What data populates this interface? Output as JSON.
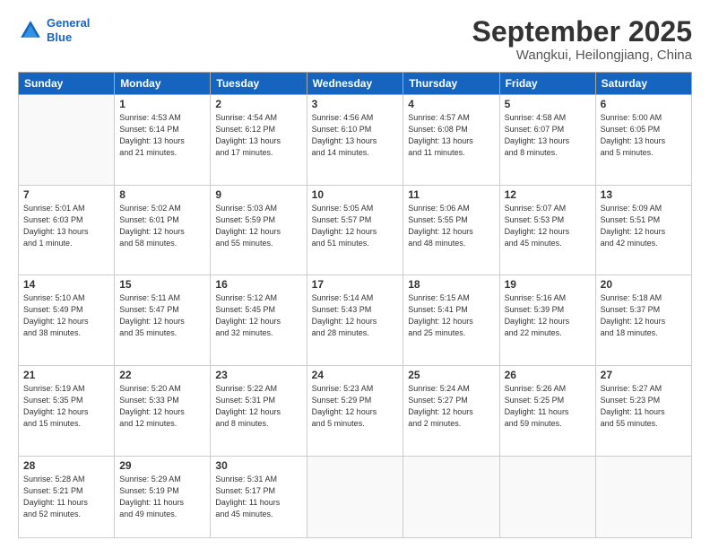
{
  "header": {
    "logo_line1": "General",
    "logo_line2": "Blue",
    "month": "September 2025",
    "location": "Wangkui, Heilongjiang, China"
  },
  "days_of_week": [
    "Sunday",
    "Monday",
    "Tuesday",
    "Wednesday",
    "Thursday",
    "Friday",
    "Saturday"
  ],
  "weeks": [
    [
      {
        "day": "",
        "info": ""
      },
      {
        "day": "1",
        "info": "Sunrise: 4:53 AM\nSunset: 6:14 PM\nDaylight: 13 hours\nand 21 minutes."
      },
      {
        "day": "2",
        "info": "Sunrise: 4:54 AM\nSunset: 6:12 PM\nDaylight: 13 hours\nand 17 minutes."
      },
      {
        "day": "3",
        "info": "Sunrise: 4:56 AM\nSunset: 6:10 PM\nDaylight: 13 hours\nand 14 minutes."
      },
      {
        "day": "4",
        "info": "Sunrise: 4:57 AM\nSunset: 6:08 PM\nDaylight: 13 hours\nand 11 minutes."
      },
      {
        "day": "5",
        "info": "Sunrise: 4:58 AM\nSunset: 6:07 PM\nDaylight: 13 hours\nand 8 minutes."
      },
      {
        "day": "6",
        "info": "Sunrise: 5:00 AM\nSunset: 6:05 PM\nDaylight: 13 hours\nand 5 minutes."
      }
    ],
    [
      {
        "day": "7",
        "info": "Sunrise: 5:01 AM\nSunset: 6:03 PM\nDaylight: 13 hours\nand 1 minute."
      },
      {
        "day": "8",
        "info": "Sunrise: 5:02 AM\nSunset: 6:01 PM\nDaylight: 12 hours\nand 58 minutes."
      },
      {
        "day": "9",
        "info": "Sunrise: 5:03 AM\nSunset: 5:59 PM\nDaylight: 12 hours\nand 55 minutes."
      },
      {
        "day": "10",
        "info": "Sunrise: 5:05 AM\nSunset: 5:57 PM\nDaylight: 12 hours\nand 51 minutes."
      },
      {
        "day": "11",
        "info": "Sunrise: 5:06 AM\nSunset: 5:55 PM\nDaylight: 12 hours\nand 48 minutes."
      },
      {
        "day": "12",
        "info": "Sunrise: 5:07 AM\nSunset: 5:53 PM\nDaylight: 12 hours\nand 45 minutes."
      },
      {
        "day": "13",
        "info": "Sunrise: 5:09 AM\nSunset: 5:51 PM\nDaylight: 12 hours\nand 42 minutes."
      }
    ],
    [
      {
        "day": "14",
        "info": "Sunrise: 5:10 AM\nSunset: 5:49 PM\nDaylight: 12 hours\nand 38 minutes."
      },
      {
        "day": "15",
        "info": "Sunrise: 5:11 AM\nSunset: 5:47 PM\nDaylight: 12 hours\nand 35 minutes."
      },
      {
        "day": "16",
        "info": "Sunrise: 5:12 AM\nSunset: 5:45 PM\nDaylight: 12 hours\nand 32 minutes."
      },
      {
        "day": "17",
        "info": "Sunrise: 5:14 AM\nSunset: 5:43 PM\nDaylight: 12 hours\nand 28 minutes."
      },
      {
        "day": "18",
        "info": "Sunrise: 5:15 AM\nSunset: 5:41 PM\nDaylight: 12 hours\nand 25 minutes."
      },
      {
        "day": "19",
        "info": "Sunrise: 5:16 AM\nSunset: 5:39 PM\nDaylight: 12 hours\nand 22 minutes."
      },
      {
        "day": "20",
        "info": "Sunrise: 5:18 AM\nSunset: 5:37 PM\nDaylight: 12 hours\nand 18 minutes."
      }
    ],
    [
      {
        "day": "21",
        "info": "Sunrise: 5:19 AM\nSunset: 5:35 PM\nDaylight: 12 hours\nand 15 minutes."
      },
      {
        "day": "22",
        "info": "Sunrise: 5:20 AM\nSunset: 5:33 PM\nDaylight: 12 hours\nand 12 minutes."
      },
      {
        "day": "23",
        "info": "Sunrise: 5:22 AM\nSunset: 5:31 PM\nDaylight: 12 hours\nand 8 minutes."
      },
      {
        "day": "24",
        "info": "Sunrise: 5:23 AM\nSunset: 5:29 PM\nDaylight: 12 hours\nand 5 minutes."
      },
      {
        "day": "25",
        "info": "Sunrise: 5:24 AM\nSunset: 5:27 PM\nDaylight: 12 hours\nand 2 minutes."
      },
      {
        "day": "26",
        "info": "Sunrise: 5:26 AM\nSunset: 5:25 PM\nDaylight: 11 hours\nand 59 minutes."
      },
      {
        "day": "27",
        "info": "Sunrise: 5:27 AM\nSunset: 5:23 PM\nDaylight: 11 hours\nand 55 minutes."
      }
    ],
    [
      {
        "day": "28",
        "info": "Sunrise: 5:28 AM\nSunset: 5:21 PM\nDaylight: 11 hours\nand 52 minutes."
      },
      {
        "day": "29",
        "info": "Sunrise: 5:29 AM\nSunset: 5:19 PM\nDaylight: 11 hours\nand 49 minutes."
      },
      {
        "day": "30",
        "info": "Sunrise: 5:31 AM\nSunset: 5:17 PM\nDaylight: 11 hours\nand 45 minutes."
      },
      {
        "day": "",
        "info": ""
      },
      {
        "day": "",
        "info": ""
      },
      {
        "day": "",
        "info": ""
      },
      {
        "day": "",
        "info": ""
      }
    ]
  ]
}
